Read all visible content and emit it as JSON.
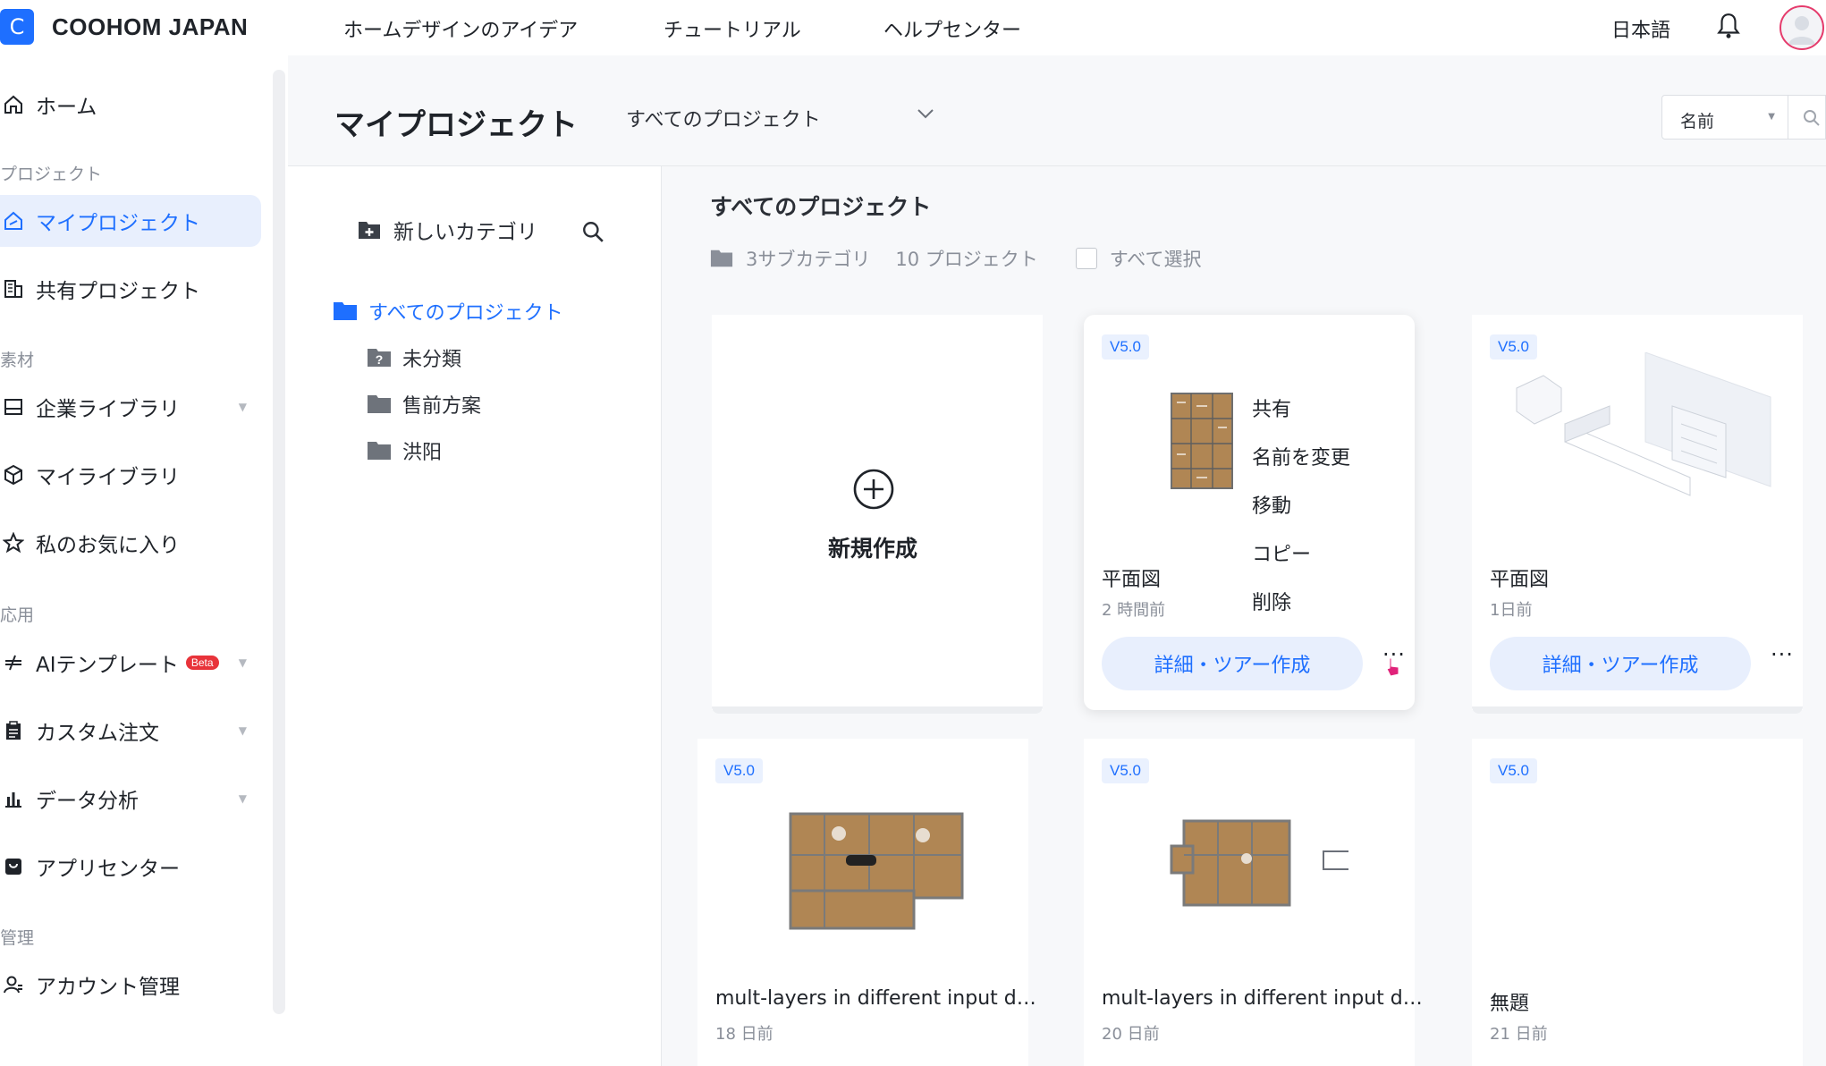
{
  "header": {
    "logo_letter": "C",
    "brand": "COOHOM JAPAN",
    "nav": [
      "ホームデザインのアイデア",
      "チュートリアル",
      "ヘルプセンター"
    ],
    "language": "日本語",
    "bell_icon": "bell-icon",
    "avatar_icon": "user-avatar-icon"
  },
  "sidebar": {
    "home": "ホーム",
    "section_project": "プロジェクト",
    "my_projects": "マイプロジェクト",
    "shared_projects": "共有プロジェクト",
    "section_material": "素材",
    "enterprise_library": "企業ライブラリ",
    "my_library": "マイライブラリ",
    "favorites": "私のお気に入り",
    "section_app": "応用",
    "ai_template": "AIテンプレート",
    "beta": "Beta",
    "custom_order": "カスタム注文",
    "data_analysis": "データ分析",
    "app_center": "アプリセンター",
    "section_admin": "管理",
    "account_admin": "アカウント管理"
  },
  "main": {
    "title": "マイプロジェクト",
    "project_filter": "すべてのプロジェクト",
    "sort_label": "名前"
  },
  "tree": {
    "new_category": "新しいカテゴリ",
    "all_projects": "すべてのプロジェクト",
    "children": [
      "未分類",
      "售前方案",
      "洪阳"
    ]
  },
  "content": {
    "title": "すべてのプロジェクト",
    "subcategories": "3サブカテゴリ",
    "projects_count": "10 プロジェクト",
    "select_all": "すべて選択",
    "new_create": "新規作成",
    "tour_button": "詳細・ツアー作成",
    "more_label": "···",
    "cards": [
      {
        "version": "V5.0",
        "name": "平面図",
        "time": "2 時間前"
      },
      {
        "version": "V5.0",
        "name": "平面図",
        "time": "1日前"
      },
      {
        "version": "V5.0",
        "name": "mult-layers in different input d…",
        "time": "18 日前"
      },
      {
        "version": "V5.0",
        "name": "mult-layers in different input d…",
        "time": "20 日前"
      },
      {
        "version": "V5.0",
        "name": "無題",
        "time": "21 日前"
      }
    ],
    "context_menu": [
      "共有",
      "名前を変更",
      "移動",
      "コピー",
      "削除"
    ]
  }
}
